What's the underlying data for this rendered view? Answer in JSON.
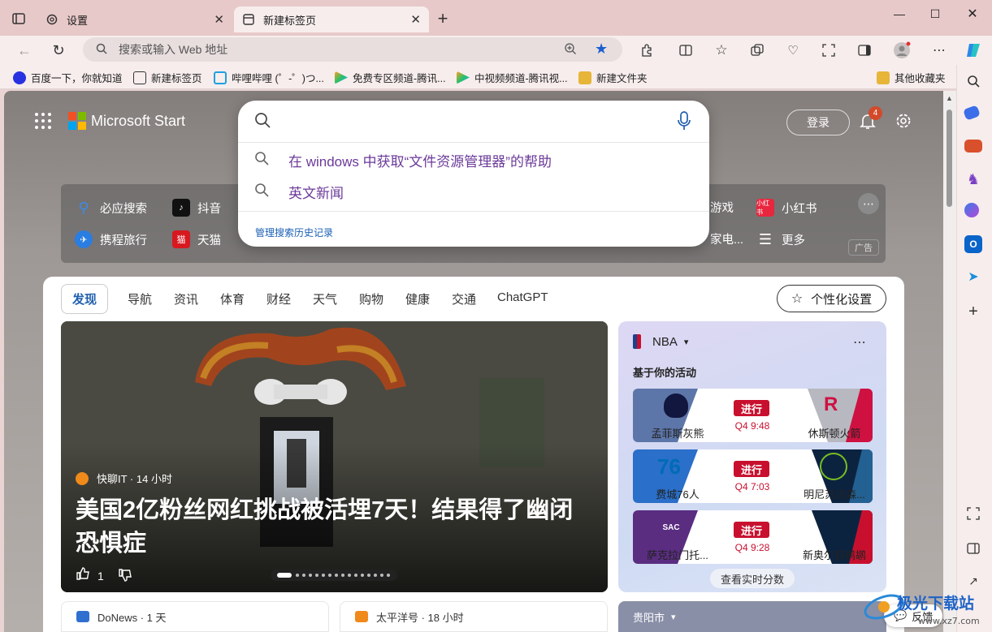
{
  "browser": {
    "tabs": [
      {
        "label": "设置",
        "icon": "gear-icon"
      },
      {
        "label": "新建标签页",
        "icon": "newtab-icon"
      }
    ],
    "address_placeholder": "搜索或输入 Web 地址",
    "favorites": [
      "百度一下，你就知道",
      "新建标签页",
      "哔哩哔哩 (゜-゜)つ...",
      "免费专区频道-腾讯...",
      "中视频频道-腾讯视...",
      "新建文件夹"
    ],
    "other_favorites": "其他收藏夹"
  },
  "start": {
    "brand": "Microsoft Start",
    "signin": "登录",
    "notifications_count": "4"
  },
  "search": {
    "suggestions": [
      "在 windows 中获取“文件资源管理器”的帮助",
      "英文新闻"
    ],
    "manage_history": "管理搜索历史记录"
  },
  "quicklinks": {
    "row1": [
      "必应搜索",
      "抖音",
      "游戏",
      "小红书"
    ],
    "row2": [
      "携程旅行",
      "天猫",
      "家电...",
      "更多"
    ],
    "ad_label": "广告"
  },
  "feed": {
    "tabs": [
      "发现",
      "导航",
      "资讯",
      "体育",
      "财经",
      "天气",
      "购物",
      "健康",
      "交通",
      "ChatGPT"
    ],
    "personalize": "个性化设置",
    "hero": {
      "source": "快聊IT · 14 小时",
      "title": "美国2亿粉丝网红挑战被活埋7天！结果得了幽闭恐惧症",
      "likes": "1"
    },
    "bottom_cards": [
      "DoNews · 1 天",
      "太平洋号 · 18 小时",
      "贵阳市"
    ]
  },
  "nba": {
    "title": "NBA",
    "subtitle": "基于你的活动",
    "games": [
      {
        "home": "孟菲斯灰熊",
        "away": "休斯顿火箭",
        "status": "进行",
        "clock": "Q4 9:48"
      },
      {
        "home": "费城76人",
        "away": "明尼苏达森...",
        "status": "进行",
        "clock": "Q4 7:03"
      },
      {
        "home": "萨克拉门托...",
        "away": "新奥尔良鹈鹕",
        "status": "进行",
        "clock": "Q4 9:28"
      }
    ],
    "live_scores": "查看实时分数"
  },
  "feedback": "反馈",
  "watermark": {
    "text": "极光下载站",
    "url": "www.xz7.com"
  },
  "colors": {
    "accent": "#1f5fae",
    "nba_red": "#c8102e",
    "suggestion": "#6b3a9a"
  }
}
